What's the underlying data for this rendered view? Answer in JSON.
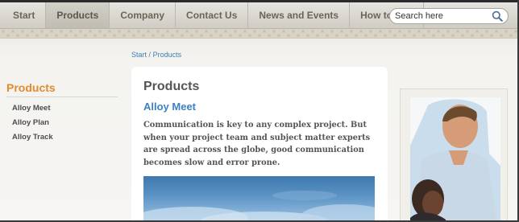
{
  "nav": {
    "items": [
      {
        "label": "Start",
        "active": false
      },
      {
        "label": "Products",
        "active": true
      },
      {
        "label": "Company",
        "active": false
      },
      {
        "label": "Contact Us",
        "active": false
      },
      {
        "label": "News and Events",
        "active": false
      },
      {
        "label": "How to buy",
        "active": false
      }
    ],
    "search": {
      "placeholder": "Search here",
      "icon": "search-icon"
    }
  },
  "breadcrumb": {
    "home": "Start",
    "separator": "/",
    "current": "Products"
  },
  "sidebar": {
    "title": "Products",
    "items": [
      {
        "label": "Alloy Meet"
      },
      {
        "label": "Alloy Plan"
      },
      {
        "label": "Alloy Track"
      }
    ]
  },
  "main": {
    "title": "Products",
    "subtitle": "Alloy Meet",
    "body": "Communication is key to any complex project.  But when your project team and subject matter experts are spread across the globe, good communication becomes slow and error prone."
  },
  "colors": {
    "accent_orange": "#e48a2e",
    "link_blue": "#3a82c4",
    "nav_text": "#6b6557"
  }
}
